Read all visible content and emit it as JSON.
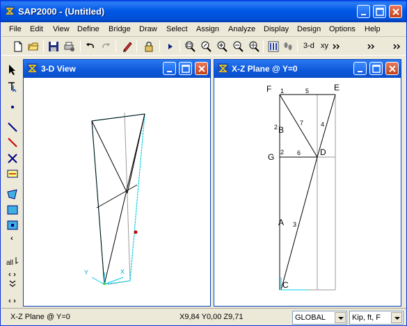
{
  "app": {
    "title": "SAP2000 - (Untitled)"
  },
  "menu": {
    "items": [
      "File",
      "Edit",
      "View",
      "Define",
      "Bridge",
      "Draw",
      "Select",
      "Assign",
      "Analyze",
      "Display",
      "Design",
      "Options",
      "Help"
    ]
  },
  "toolbar": {
    "view_3d_label": "3-d",
    "view_xy_label": "xy"
  },
  "left_window": {
    "title": "3-D View"
  },
  "right_window": {
    "title": "X-Z Plane @ Y=0",
    "labels": {
      "F": "F",
      "E": "E",
      "G": "G",
      "D": "D",
      "B": "B",
      "A": "A",
      "C": "C",
      "n1": "1",
      "n2": "2",
      "n5": "5",
      "n6": "6",
      "n7": "7",
      "n4": "4",
      "n3": "3"
    }
  },
  "left_axes": {
    "x": "X",
    "y": "Y"
  },
  "status": {
    "view_label": "X-Z Plane @ Y=0",
    "coords": "X9,84  Y0,00  Z9,71",
    "coord_system": "GLOBAL",
    "units": "Kip, ft, F"
  },
  "colors": {
    "frame_member": "#000000",
    "grid_line": "#808080",
    "cyan_edge": "#00d0e0",
    "axis_cyan": "#00c8e8",
    "marker_red": "#d00000"
  }
}
